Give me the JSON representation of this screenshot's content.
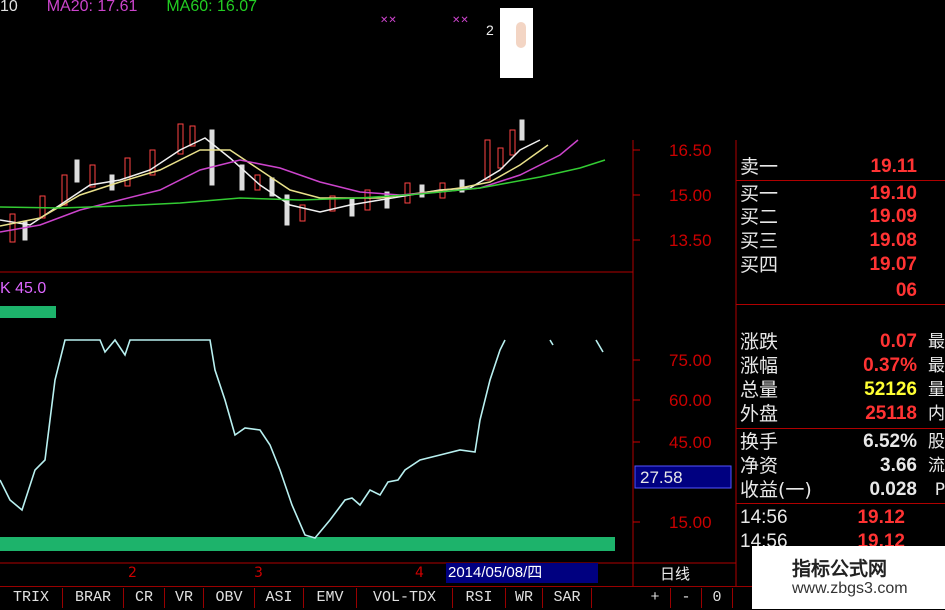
{
  "ma_legend": [
    {
      "label": "10",
      "color": "#ffffff"
    },
    {
      "label": "MA20: 17.61",
      "color": "#cc44cc"
    },
    {
      "label": "MA60: 16.07",
      "color": "#22cc22"
    }
  ],
  "marker_2": "2",
  "axis_top": [
    "16.50",
    "15.00",
    "13.50"
  ],
  "indicator_value_label": "K 45.0",
  "axis_bottom": [
    "75.00",
    "60.00",
    "45.00",
    "15.00"
  ],
  "indicator_current": "27.58",
  "date_label": "2014/05/08/四",
  "period_label": "日线",
  "x_markers": [
    "2",
    "3",
    "4"
  ],
  "quote_rows": [
    {
      "label": "卖一",
      "value": "19.11",
      "color": "#ff3333",
      "extra": ""
    },
    {
      "label": "买一",
      "value": "19.10",
      "color": "#ff3333",
      "extra": ""
    },
    {
      "label": "买二",
      "value": "19.09",
      "color": "#ff3333",
      "extra": ""
    },
    {
      "label": "买三",
      "value": "19.08",
      "color": "#ff3333",
      "extra": ""
    },
    {
      "label": "买四",
      "value": "19.07",
      "color": "#ff3333",
      "extra": ""
    },
    {
      "label": "",
      "value": "06",
      "color": "#ff3333",
      "extra": ""
    },
    {
      "label": "涨跌",
      "value": "0.07",
      "color": "#ff3333",
      "extra": "最"
    },
    {
      "label": "涨幅",
      "value": "0.37%",
      "color": "#ff3333",
      "extra": "最"
    },
    {
      "label": "总量",
      "value": "52126",
      "color": "#ffff33",
      "extra": "量"
    },
    {
      "label": "外盘",
      "value": "25118",
      "color": "#ff3333",
      "extra": "内"
    },
    {
      "label": "换手",
      "value": "6.52%",
      "color": "#e8e8e8",
      "extra": "股"
    },
    {
      "label": "净资",
      "value": "3.66",
      "color": "#e8e8e8",
      "extra": "流"
    },
    {
      "label": "收益(一)",
      "value": "0.028",
      "color": "#e8e8e8",
      "extra": "P"
    }
  ],
  "trades": [
    {
      "time": "14:56",
      "price": "19.12"
    },
    {
      "time": "14:56",
      "price": "19.12"
    }
  ],
  "tabs": [
    "TRIX",
    "BRAR",
    "CR",
    "VR",
    "OBV",
    "ASI",
    "EMV",
    "VOL-TDX",
    "RSI",
    "WR",
    "SAR"
  ],
  "tab_buttons": [
    "+",
    "-",
    "0"
  ],
  "watermark": {
    "title": "指标公式网",
    "url": "www.zbgs3.com"
  }
}
